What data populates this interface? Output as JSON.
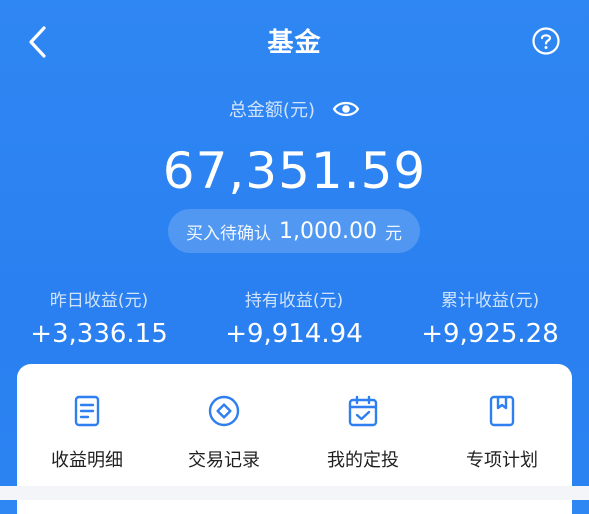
{
  "header": {
    "title": "基金",
    "back_icon": "back-chevron-icon",
    "help_icon": "question-circle-icon"
  },
  "summary": {
    "total_label": "总金额(元)",
    "visibility_icon": "eye-icon",
    "total_amount": "67,351.59",
    "pending_label": "买入待确认",
    "pending_amount": "1,000.00",
    "pending_unit": "元"
  },
  "stats": [
    {
      "label": "昨日收益(元)",
      "value": "+3,336.15"
    },
    {
      "label": "持有收益(元)",
      "value": "+9,914.94"
    },
    {
      "label": "累计收益(元)",
      "value": "+9,925.28"
    }
  ],
  "actions": [
    {
      "label": "收益明细",
      "icon": "document-list-icon"
    },
    {
      "label": "交易记录",
      "icon": "diamond-circle-icon"
    },
    {
      "label": "我的定投",
      "icon": "calendar-check-icon"
    },
    {
      "label": "专项计划",
      "icon": "bookmark-book-icon"
    }
  ],
  "colors": {
    "background": "#2b82f1",
    "accent_icon": "#2f7ff0",
    "card": "#ffffff"
  }
}
